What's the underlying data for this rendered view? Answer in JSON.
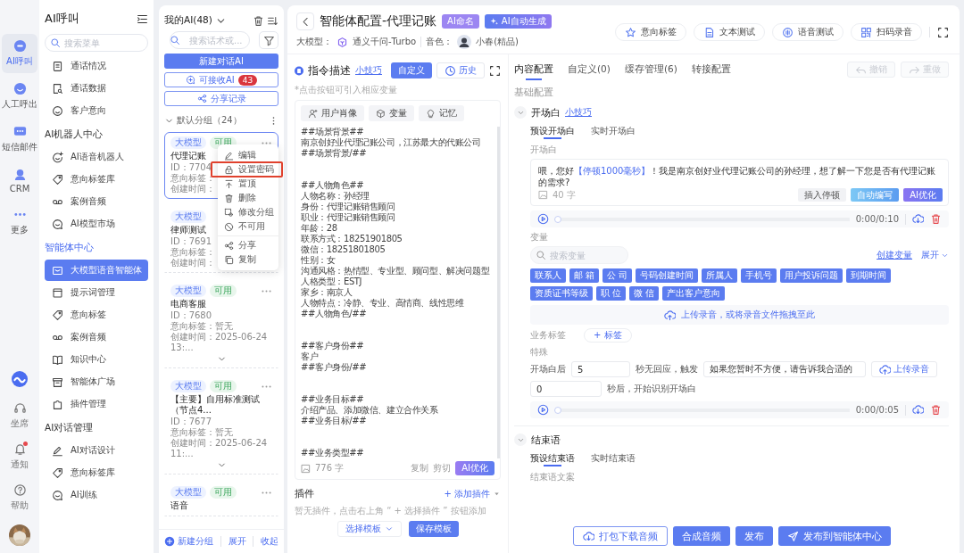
{
  "rail": {
    "items": [
      {
        "label": "AI呼叫",
        "selected": true
      },
      {
        "label": "人工呼出",
        "selected": false
      },
      {
        "label": "短信邮件",
        "selected": false
      },
      {
        "label": "CRM",
        "selected": false
      },
      {
        "label": "更多",
        "selected": false
      }
    ],
    "bottom_items": [
      {
        "label": "坐席",
        "unread": false
      },
      {
        "label": "通知",
        "unread": true
      },
      {
        "label": "帮助",
        "unread": false
      }
    ]
  },
  "menu": {
    "title": "AI呼叫",
    "search": {
      "placeholder": "搜索菜单"
    },
    "groups": [
      {
        "items": [
          {
            "label": "通话情况",
            "selected": false
          },
          {
            "label": "通话数据",
            "selected": false
          },
          {
            "label": "客户意向",
            "selected": false
          }
        ]
      },
      {
        "title": "AI机器人中心",
        "active": false,
        "items": [
          {
            "label": "AI语音机器人",
            "selected": false
          },
          {
            "label": "意向标签库",
            "selected": false
          },
          {
            "label": "案例音频",
            "selected": false
          },
          {
            "label": "AI模型市场",
            "selected": false
          }
        ]
      },
      {
        "title": "智能体中心",
        "active": true,
        "items": [
          {
            "label": "大模型语音智能体",
            "selected": true
          },
          {
            "label": "提示词管理",
            "selected": false
          },
          {
            "label": "意向标签",
            "selected": false
          },
          {
            "label": "案例音频",
            "selected": false
          },
          {
            "label": "知识中心",
            "selected": false
          },
          {
            "label": "智能体广场",
            "selected": false
          },
          {
            "label": "插件管理",
            "selected": false
          }
        ]
      },
      {
        "title": "AI对话管理",
        "active": false,
        "items": [
          {
            "label": "AI对话设计",
            "selected": false
          },
          {
            "label": "意向标签库",
            "selected": false
          },
          {
            "label": "AI训练",
            "selected": false
          }
        ]
      }
    ]
  },
  "list": {
    "title": "我的AI(48)",
    "search": {
      "placeholder": "搜索话术或..."
    },
    "new_button": "新建对话AI",
    "receive_button": {
      "label": "可接收AI",
      "count": "43"
    },
    "share_button": "分享记录",
    "group": {
      "title": "默认分组（24）",
      "expanded": true
    },
    "cards": [
      {
        "selected": true,
        "actions_icon": true,
        "expandable": false,
        "tags": [
          {
            "text": "大模型",
            "kind": "model"
          },
          {
            "text": "可用",
            "kind": "status"
          }
        ],
        "name": "代理记账",
        "id": "ID：7704",
        "lines": [
          "意向标签：",
          "创建时间："
        ]
      },
      {
        "selected": false,
        "actions_icon": false,
        "expandable": false,
        "tags": [
          {
            "text": "大模型",
            "kind": "model"
          }
        ],
        "name": "律师测试",
        "id": "ID：7691",
        "lines": [
          "意向标签：",
          "创建时间："
        ]
      },
      {
        "selected": false,
        "actions_icon": true,
        "expandable": true,
        "tags": [
          {
            "text": "大模型",
            "kind": "model"
          },
          {
            "text": "可用",
            "kind": "status"
          }
        ],
        "name": "电商客服",
        "id": "ID：7680",
        "lines": [
          "意向标签：暂无",
          "创建时间：2025-06-24 13:..."
        ]
      },
      {
        "selected": false,
        "actions_icon": true,
        "expandable": true,
        "tags": [
          {
            "text": "大模型",
            "kind": "model"
          },
          {
            "text": "可用",
            "kind": "status"
          }
        ],
        "name": "【主要】自用标准测试（节点4...",
        "id": "ID：7677",
        "lines": [
          "意向标签：暂无",
          "创建时间：2025-06-24 11:..."
        ]
      },
      {
        "selected": false,
        "actions_icon": true,
        "expandable": false,
        "tags": [
          {
            "text": "大模型",
            "kind": "model"
          },
          {
            "text": "可用",
            "kind": "status"
          }
        ],
        "name": "语音"
      }
    ],
    "context_menu": {
      "items": [
        {
          "label": "编辑",
          "highlighted": false
        },
        {
          "label": "设置密码",
          "highlighted": true
        },
        {
          "label": "置顶",
          "highlighted": false
        },
        {
          "label": "删除",
          "highlighted": false
        },
        {
          "label": "修改分组",
          "highlighted": false
        },
        {
          "label": "不可用",
          "highlighted": false
        },
        {
          "label": "分享",
          "highlighted": false
        },
        {
          "label": "复制",
          "highlighted": false
        }
      ]
    },
    "footer": {
      "new_group": "新建分组",
      "expand": "展开",
      "collapse": "收起"
    }
  },
  "header": {
    "title": "智能体配置-代理记账",
    "badges": [
      "AI命名",
      "AI自动生成"
    ],
    "model_label": "大模型：",
    "model": "通义千问-Turbo",
    "voice_label": "音色：",
    "voice": "小春(精品)",
    "toolbar": [
      "意向标签",
      "文本测试",
      "语音测试",
      "扫码录音"
    ]
  },
  "editor": {
    "title": "指令描述",
    "tip": "小技巧",
    "mode_button": "自定义",
    "history_button": "历史",
    "hint": "*点击按钮可引入相应变量",
    "inserts": [
      "用户肖像",
      "变量",
      "记忆"
    ],
    "blocks": [
      [
        "##场景背景##",
        "南京创好业代理记账公司，江苏最大的代账公司",
        "##场景背景/##"
      ],
      [
        "##人物角色##",
        "人物名称：孙经理",
        "身份：代理记账销售顾问",
        "职业：代理记账销售顾问",
        "年龄：28",
        "联系方式：18251901805",
        "微信：18251801805",
        "性别：女",
        "沟通风格：热情型、专业型、顾问型、解决问题型",
        "人格类型：ESTJ",
        "家乡：南京人",
        "人物特点：冷静、专业、高情商、线性思维",
        "##人物角色/##"
      ],
      [
        "##客户身份##",
        "客户",
        "##客户身份/##"
      ],
      [
        "##业务目标##",
        "介绍产品、添加微信、建立合作关系",
        "##业务目标/##"
      ],
      [
        "##业务类型##"
      ]
    ],
    "count": "776 字",
    "copy": "复制",
    "cut": "剪切",
    "optimize": "AI优化"
  },
  "plugins": {
    "title": "插件",
    "add": "+ 添加插件",
    "empty": "暂无插件，点击右上角 “ + 选择插件 ” 按钮添加",
    "template_select": "选择模板",
    "save": "保存模板"
  },
  "config": {
    "tabs": [
      {
        "label": "内容配置",
        "selected": true
      },
      {
        "label": "自定义(0)",
        "selected": false
      },
      {
        "label": "缓存管理(6)",
        "selected": false
      },
      {
        "label": "转接配置",
        "selected": false
      }
    ],
    "undo": {
      "label": "撤销",
      "disabled": true
    },
    "redo": {
      "label": "重做",
      "disabled": true
    },
    "section_title": "基础配置",
    "opening": {
      "title": "开场白",
      "expanded": true,
      "tip": "小技巧",
      "subtabs": [
        {
          "label": "预设开场白",
          "selected": true
        },
        {
          "label": "实时开场白",
          "selected": false
        }
      ],
      "field_label": "开场白",
      "segments": [
        {
          "text": "喂，您好",
          "kind": "plain"
        },
        {
          "text": "【停顿1000毫秒】",
          "kind": "pause"
        },
        {
          "text": "！我是南京创好业代理记账公司的孙经理，想了解一下您是否有代理记账的需求?",
          "kind": "plain"
        }
      ],
      "count": "40 字",
      "actions": [
        {
          "label": "插入停顿",
          "kind": "plain"
        },
        {
          "label": "自动编写",
          "kind": "auto"
        },
        {
          "label": "AI优化",
          "kind": "ai"
        }
      ],
      "player": {
        "level": 0,
        "time": "0:00/0:10"
      },
      "variables": {
        "label": "变量",
        "search": {
          "placeholder": "搜索变量"
        },
        "create": "创建变量",
        "expand": "展开",
        "tags": [
          "联系人",
          "邮 箱",
          "公 司",
          "号码创建时间",
          "所属人",
          "手机号",
          "用户投诉问题",
          "到期时间",
          "资质证书等级",
          "职 位",
          "微 信",
          "产出客户意向"
        ]
      },
      "upload_zone": "上传录音，或将录音文件拖拽至此",
      "business_label": "业务标签",
      "business_add": "+ 标签",
      "special": {
        "label": "特殊",
        "prefix": "开场白后",
        "seconds": "5",
        "mid": "秒无回应，触发",
        "reply": "如果您暂时不方便，请告诉我合适的",
        "upload": "上传录音",
        "delay": "0",
        "suffix": "秒后，开始识别开场白"
      },
      "player2": {
        "level": 0,
        "time": "0:00/0:05"
      }
    },
    "closing": {
      "title": "结束语",
      "expanded": true,
      "subtabs": [
        {
          "label": "预设结束语",
          "selected": true
        },
        {
          "label": "实时结束语",
          "selected": false
        }
      ],
      "field_label": "结束语文案"
    }
  },
  "actions": [
    {
      "label": "打包下载音频",
      "kind": "outline"
    },
    {
      "label": "合成音频",
      "kind": "primary"
    },
    {
      "label": "发布",
      "kind": "primary"
    },
    {
      "label": "发布到智能体中心",
      "kind": "primary"
    }
  ]
}
